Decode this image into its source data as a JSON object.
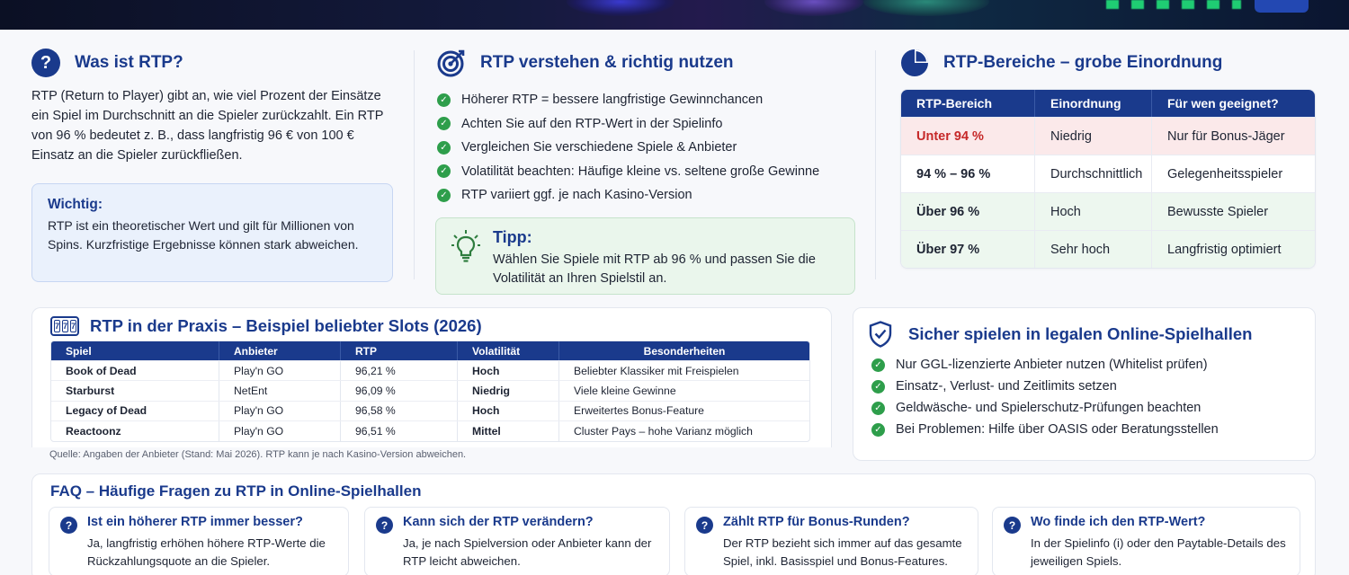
{
  "colors": {
    "brand": "#1a3a8c",
    "green": "#2e9e4b",
    "red": "#c62828"
  },
  "what": {
    "title": "Was ist RTP?",
    "icon": "question-circle-icon",
    "body": "RTP (Return to Player) gibt an, wie viel Prozent der Einsätze ein Spiel im Durchschnitt an die Spieler zurückzahlt. Ein RTP von 96 % bedeutet z. B., dass langfristig 96 € von 100 € Einsatz an die Spieler zurückfließen.",
    "note_title": "Wichtig:",
    "note_body": "RTP ist ein theoretischer Wert und gilt für Millionen von Spins. Kurzfristige Ergebnisse können stark abweichen."
  },
  "use": {
    "title": "RTP verstehen & richtig nutzen",
    "icon": "target-icon",
    "items": [
      "Höherer RTP = bessere langfristige Gewinnchancen",
      "Achten Sie auf den RTP-Wert in der Spielinfo",
      "Vergleichen Sie verschiedene Spiele & Anbieter",
      "Volatilität beachten: Häufige kleine vs. seltene große Gewinne",
      "RTP variiert ggf. je nach Kasino-Version"
    ],
    "tip_title": "Tipp:",
    "tip_body": "Wählen Sie Spiele mit RTP ab 96 % und passen Sie die Volatilität an Ihren Spielstil an."
  },
  "ranges": {
    "title": "RTP-Bereiche – grobe Einordnung",
    "icon": "pie-chart-icon",
    "headers": [
      "RTP-Bereich",
      "Einordnung",
      "Für wen geeignet?"
    ],
    "rows": [
      [
        "Unter 94 %",
        "Niedrig",
        "Nur für Bonus-Jäger"
      ],
      [
        "94 % – 96 %",
        "Durchschnittlich",
        "Gelegenheitsspieler"
      ],
      [
        "Über 96 %",
        "Hoch",
        "Bewusste Spieler"
      ],
      [
        "Über 97 %",
        "Sehr hoch",
        "Langfristig optimiert"
      ]
    ]
  },
  "slots": {
    "title": "RTP in der Praxis – Beispiel beliebter Slots (2026)",
    "icon": "slot-machine-icon",
    "icon_glyph": "7",
    "headers": [
      "Spiel",
      "Anbieter",
      "RTP",
      "Volatilität",
      "Besonderheiten"
    ],
    "rows": [
      [
        "Book of Dead",
        "Play'n GO",
        "96,21 %",
        "Hoch",
        "Beliebter Klassiker mit Freispielen"
      ],
      [
        "Starburst",
        "NetEnt",
        "96,09 %",
        "Niedrig",
        "Viele kleine Gewinne"
      ],
      [
        "Legacy of Dead",
        "Play'n GO",
        "96,58 %",
        "Hoch",
        "Erweitertes Bonus-Feature"
      ],
      [
        "Reactoonz",
        "Play'n GO",
        "96,51 %",
        "Mittel",
        "Cluster Pays – hohe Varianz möglich"
      ]
    ],
    "source": "Quelle: Angaben der Anbieter (Stand: Mai 2026). RTP kann je nach Kasino-Version abweichen."
  },
  "safe": {
    "title": "Sicher spielen in legalen Online-Spielhallen",
    "icon": "shield-check-icon",
    "items": [
      "Nur GGL-lizenzierte Anbieter nutzen (Whitelist prüfen)",
      "Einsatz-, Verlust- und Zeitlimits setzen",
      "Geldwäsche- und Spielerschutz-Prüfungen beachten",
      "Bei Problemen: Hilfe über OASIS oder Beratungsstellen"
    ]
  },
  "faq": {
    "title": "FAQ – Häufige Fragen zu RTP in Online-Spielhallen",
    "items": [
      {
        "q": "Ist ein höherer RTP immer besser?",
        "a": "Ja, langfristig erhöhen höhere RTP-Werte die Rückzahlungsquote an die Spieler."
      },
      {
        "q": "Kann sich der RTP verändern?",
        "a": "Ja, je nach Spielversion oder Anbieter kann der RTP leicht abweichen."
      },
      {
        "q": "Zählt RTP für Bonus-Runden?",
        "a": "Der RTP bezieht sich immer auf das gesamte Spiel, inkl. Basisspiel und Bonus-Features."
      },
      {
        "q": "Wo finde ich den RTP-Wert?",
        "a": "In der Spielinfo (i) oder den Paytable-Details des jeweiligen Spiels."
      }
    ]
  }
}
